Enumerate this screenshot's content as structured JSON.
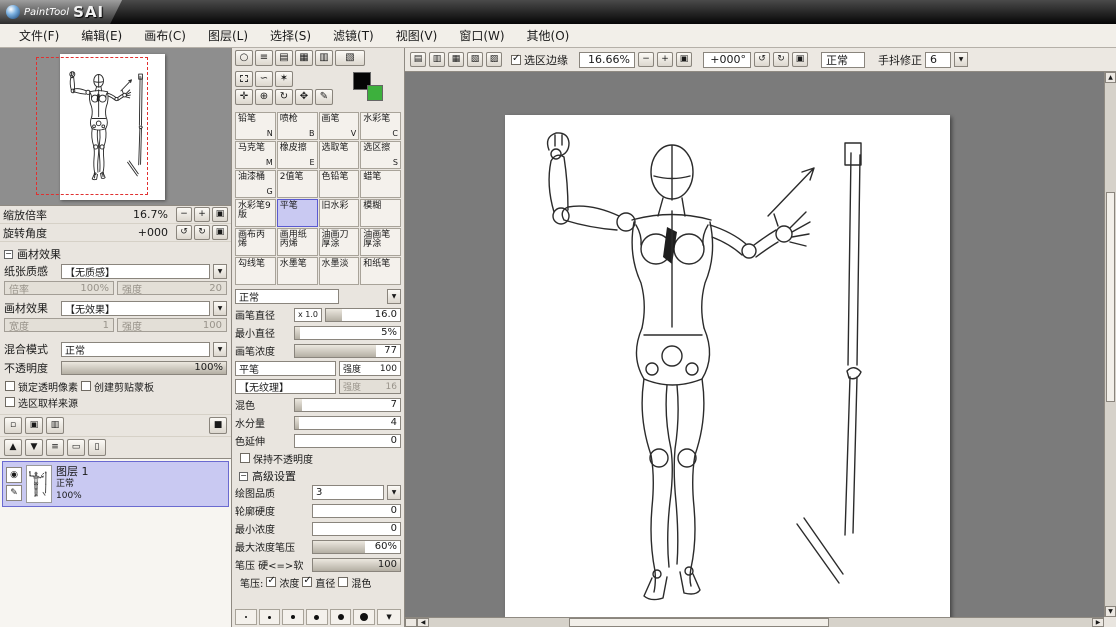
{
  "titlebar": {
    "script": "PaintTool",
    "name": "SAI"
  },
  "menubar": {
    "items": [
      {
        "label": "文件(F)"
      },
      {
        "label": "编辑(E)"
      },
      {
        "label": "画布(C)"
      },
      {
        "label": "图层(L)"
      },
      {
        "label": "选择(S)"
      },
      {
        "label": "滤镜(T)"
      },
      {
        "label": "视图(V)"
      },
      {
        "label": "窗口(W)"
      },
      {
        "label": "其他(O)"
      }
    ]
  },
  "canvas_toolbar": {
    "selection_edge": "选区边缘",
    "selection_edge_checked": true,
    "zoom": "16.66%",
    "rotation": "+000°",
    "mode": "正常",
    "stabilizer_label": "手抖修正",
    "stabilizer": "6"
  },
  "navigator": {
    "zoom_label": "缩放倍率",
    "zoom": "16.7%",
    "rotation_label": "旋转角度",
    "rotation": "+000"
  },
  "material": {
    "title": "画材效果",
    "paper_label": "纸张质感",
    "paper": "【无质感】",
    "scale_label": "倍率",
    "scale": "100%",
    "strength_label": "强度",
    "strength": "20",
    "effect_label": "画材效果",
    "effect": "【无效果】",
    "width_label": "宽度",
    "width": "1",
    "strength2_label": "强度",
    "strength2": "100"
  },
  "layer_panel": {
    "blend_label": "混合模式",
    "blend": "正常",
    "opacity_label": "不透明度",
    "opacity": "100%",
    "lock_alpha": "锁定透明像素",
    "lock_alpha_checked": false,
    "clipping": "创建剪贴蒙板",
    "clipping_checked": false,
    "selection_source": "选区取样来源",
    "selection_source_checked": false,
    "layers": [
      {
        "name": "图层 1",
        "mode": "正常",
        "opacity": "100%"
      }
    ]
  },
  "tools": {
    "selected_index": 13,
    "grid": [
      {
        "name": "铅笔",
        "key": "N"
      },
      {
        "name": "喷枪",
        "key": "B"
      },
      {
        "name": "画笔",
        "key": "V"
      },
      {
        "name": "水彩笔",
        "key": "C"
      },
      {
        "name": "马克笔",
        "key": "M"
      },
      {
        "name": "橡皮擦",
        "key": "E"
      },
      {
        "name": "选取笔",
        "key": ""
      },
      {
        "name": "选区擦",
        "key": "S"
      },
      {
        "name": "油漆桶",
        "key": "G"
      },
      {
        "name": "2值笔",
        "key": ""
      },
      {
        "name": "色铅笔",
        "key": ""
      },
      {
        "name": "蜡笔",
        "key": ""
      },
      {
        "name": "水彩笔9版",
        "key": ""
      },
      {
        "name": "平笔",
        "key": ""
      },
      {
        "name": "旧水彩",
        "key": ""
      },
      {
        "name": "模糊",
        "key": ""
      },
      {
        "name": "画布丙烯",
        "key": ""
      },
      {
        "name": "画用纸丙烯",
        "key": ""
      },
      {
        "name": "油画刀厚涂",
        "key": ""
      },
      {
        "name": "油画笔厚涂",
        "key": ""
      },
      {
        "name": "勾线笔",
        "key": ""
      },
      {
        "name": "水墨笔",
        "key": ""
      },
      {
        "name": "水墨淡",
        "key": ""
      },
      {
        "name": "和纸笔",
        "key": ""
      }
    ]
  },
  "brush": {
    "blend": "正常",
    "diameter_label": "画笔直径",
    "diameter_mult": "x 1.0",
    "diameter": "16.0",
    "min_size_label": "最小直径",
    "min_size": "5%",
    "density_label": "画笔浓度",
    "density": "77",
    "shape": "平笔",
    "strength_label": "强度",
    "shape_strength": "100",
    "texture": "【无纹理】",
    "texture_strength": "16",
    "mix_label": "混色",
    "mix": "7",
    "water_label": "水分量",
    "water": "4",
    "spread_label": "色延伸",
    "spread": "0",
    "keep_opacity": "保持不透明度",
    "keep_opacity_checked": false
  },
  "advanced": {
    "title": "高级设置",
    "quality_label": "绘图品质",
    "quality": "3",
    "edge_label": "轮廓硬度",
    "edge": "0",
    "min_density_label": "最小浓度",
    "min_density": "0",
    "max_density_label": "最大浓度笔压",
    "max_density": "60%",
    "pressure_soft_label": "笔压 硬<=>软",
    "pressure_soft": "100",
    "pressure_prefix": "笔压:",
    "p_density": "浓度",
    "p_density_checked": true,
    "p_diameter": "直径",
    "p_diameter_checked": true,
    "p_mix": "混色",
    "p_mix_checked": false
  },
  "icons": {
    "minus": "−",
    "plus": "+",
    "reset": "▣",
    "rotate_ccw": "↺",
    "rotate_cw": "↻",
    "arrow_down": "▼",
    "arrow_up": "▲",
    "arrow_left": "◀",
    "arrow_right": "▶",
    "eye": "◉",
    "pen": "✎",
    "collapse": "−",
    "color_wheel": "○",
    "rgb_bars": "≡",
    "hsv_bars": "▤",
    "mixer": "▦",
    "scratchpad": "▥",
    "swatches": "▧",
    "lasso": "∽",
    "wand": "✶",
    "move": "✛",
    "magnifier": "⊕",
    "rotate_view": "↻",
    "hand": "✥",
    "dropper": "✎",
    "new_layer": "▫",
    "new_folder": "▣",
    "transfer": "▥",
    "mask": "■",
    "up": "▲",
    "down": "▼",
    "merge": "≡",
    "clear": "▭",
    "trash": "▯",
    "tb1": "▤",
    "tb2": "▥",
    "tb3": "▦",
    "tb4": "▧",
    "tb5": "▨"
  }
}
